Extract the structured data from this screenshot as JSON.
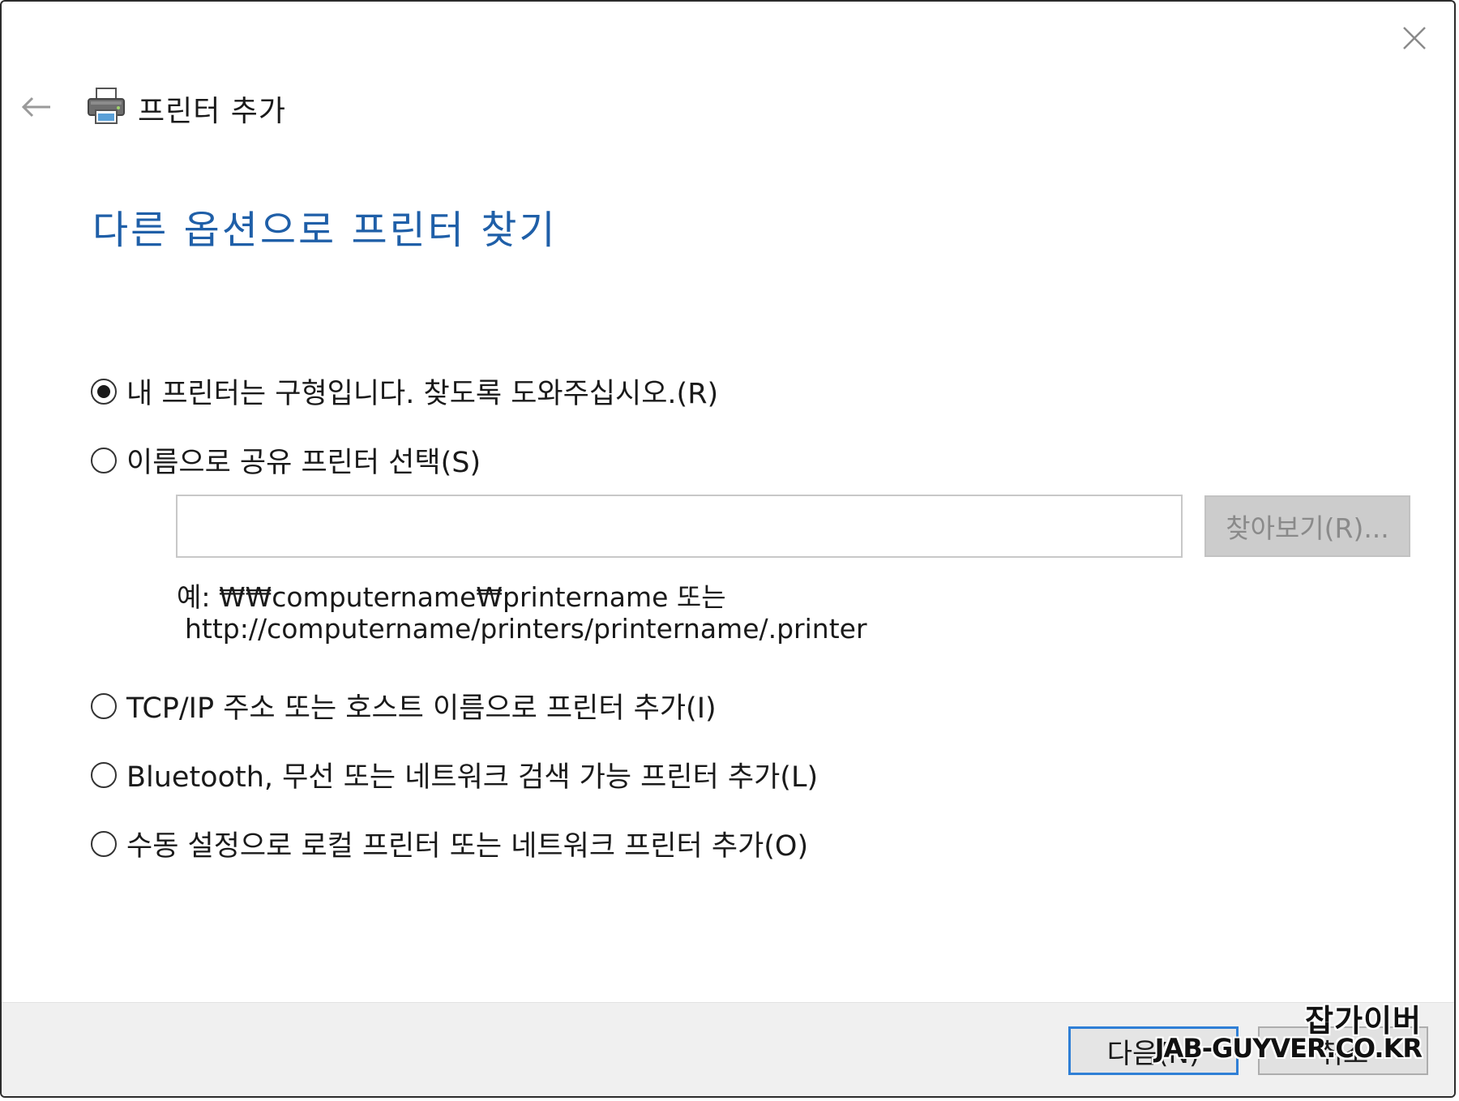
{
  "window": {
    "title": "프린터 추가",
    "close_icon": "close-icon",
    "back_icon": "back-arrow-icon",
    "title_icon": "printer-icon"
  },
  "heading": "다른 옵션으로 프린터 찾기",
  "options": [
    {
      "label": "내 프린터는 구형입니다. 찾도록 도와주십시오.(R)",
      "selected": true
    },
    {
      "label": "이름으로 공유 프린터 선택(S)",
      "selected": false
    },
    {
      "label": "TCP/IP 주소 또는 호스트 이름으로 프린터 추가(I)",
      "selected": false
    },
    {
      "label": "Bluetooth, 무선 또는 네트워크 검색 가능 프린터 추가(L)",
      "selected": false
    },
    {
      "label": "수동 설정으로 로컬 프린터 또는 네트워크 프린터 추가(O)",
      "selected": false
    }
  ],
  "shared_printer": {
    "input_value": "",
    "browse_label": "찾아보기(R)...",
    "example_line1": "예: ₩₩computername₩printername 또는",
    "example_line2": "http://computername/printers/printername/.printer"
  },
  "footer": {
    "next_label": "다음(N)",
    "cancel_label": "취소"
  },
  "watermark": {
    "korean": "잡가이버",
    "english": "JAB-GUYVER.CO.KR"
  },
  "colors": {
    "heading": "#1f5fa8",
    "next_border": "#2f7fd6",
    "footer_bg": "#f0f0f0"
  }
}
